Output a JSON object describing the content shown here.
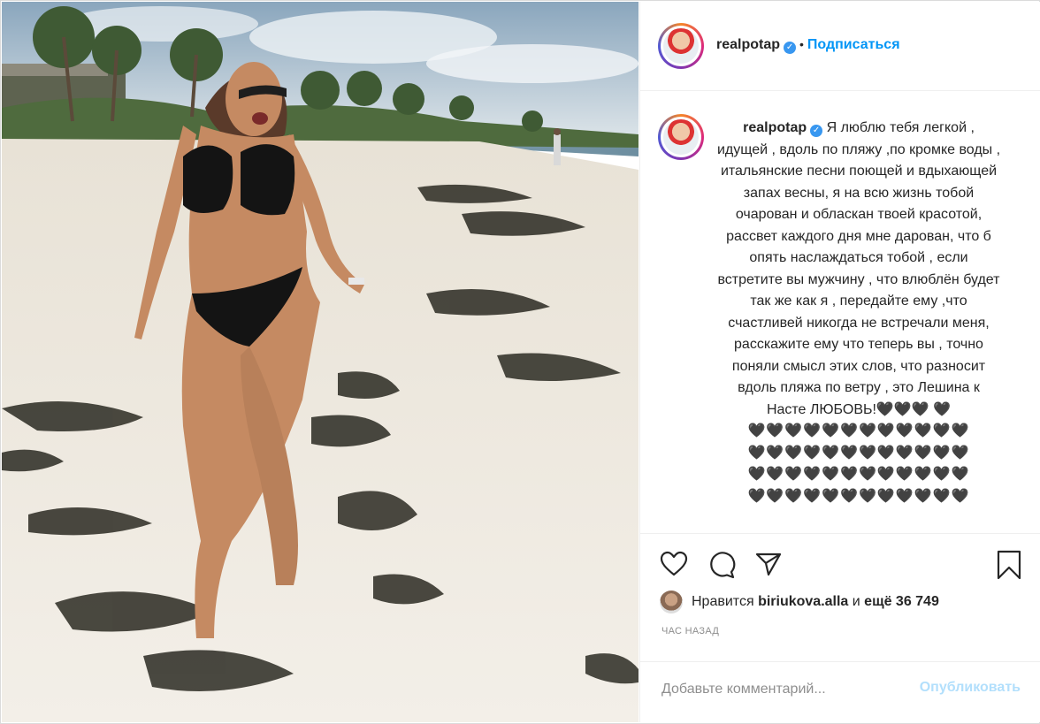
{
  "post": {
    "username": "realpotap",
    "follow_label": "Подписаться",
    "dot": "•",
    "verified_glyph": "✓",
    "caption_text": "Я люблю тебя легкой , идущей , вдоль по пляжу ,по кромке воды , итальянские песни поющей и вдыхающей запах весны, я на всю жизнь тобой очарован и обласкан твоей красотой, рассвет каждого дня мне дарован, что б опять наслаждаться тобой , если встретите вы мужчину , что влюблён будет так же как я , передайте ему ,что счастливей никогда не встречали меня, расскажите ему что теперь вы , точно поняли смысл этих слов, что разносит вдоль пляжа по ветру , это Лешина к Насте ЛЮБОВЬ!🖤🖤🖤 🖤",
    "hearts_lines": [
      "🖤🖤🖤🖤🖤🖤🖤🖤🖤🖤🖤🖤",
      "🖤🖤🖤🖤🖤🖤🖤🖤🖤🖤🖤🖤",
      "🖤🖤🖤🖤🖤🖤🖤🖤🖤🖤🖤🖤",
      "🖤🖤🖤🖤🖤🖤🖤🖤🖤🖤🖤🖤"
    ]
  },
  "likes": {
    "prefix": "Нравится",
    "user": "biriukova.alla",
    "middle": "и",
    "count_text": "ещё 36 749"
  },
  "time_label": "час назад",
  "comment": {
    "placeholder": "Добавьте комментарий...",
    "publish_label": "Опубликовать"
  },
  "icons": {
    "like": "heart-icon",
    "comment": "comment-icon",
    "share": "share-icon",
    "save": "bookmark-icon"
  }
}
